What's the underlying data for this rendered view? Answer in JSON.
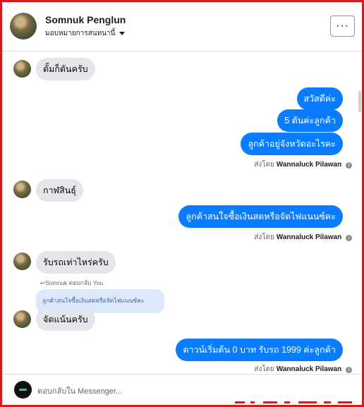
{
  "header": {
    "name": "Somnuk Penglun",
    "assign_label": "มอบหมายการสนทนานี้",
    "more_label": "···"
  },
  "messages": [
    {
      "kind": "in",
      "text": "ตั้มก็ตันครับ"
    },
    {
      "kind": "out",
      "text": "สวัสดีค่ะ"
    },
    {
      "kind": "out",
      "text": "5 ตันค่ะลูกค้า"
    },
    {
      "kind": "out",
      "text": "ลูกค้าอยู่จังหวัดอะไรคะ"
    },
    {
      "kind": "in",
      "text": "กาฬสินธุ์"
    },
    {
      "kind": "out",
      "text": "ลูกค้าสนใจซื้อเงินสดหรือจัดไฟแนนซ์คะ"
    },
    {
      "kind": "in",
      "text": "รับรถเท่าไหร่ครับ"
    },
    {
      "kind": "in",
      "text": "จัดแน้นครับ"
    },
    {
      "kind": "out",
      "text": "ดาวน์เริ่มต้น 0 บาท รับรถ 1999 ค่ะลูกค้า"
    }
  ],
  "sent_by": {
    "prefix": "ส่งโดย",
    "agent": "Wannaluck Pilawan",
    "info_icon": "i"
  },
  "reply": {
    "meta": "↩Somnuk ตอบกลับ You",
    "quoted_text": "ลูกค้าสนใจซื้อเงินสดหรือจัดไฟแนนซ์คะ"
  },
  "footer": {
    "placeholder": "ตอบกลับใน Messenger..."
  },
  "icons": {
    "more": "ellipsis-icon",
    "caret": "caret-down-icon",
    "info": "info-icon",
    "reply": "reply-arrow-icon"
  },
  "colors": {
    "outgoing_bubble": "#0a7cff",
    "incoming_bubble": "#e4e6eb",
    "quoted_bubble": "#dce8fb",
    "frame_border": "#e0151b"
  }
}
